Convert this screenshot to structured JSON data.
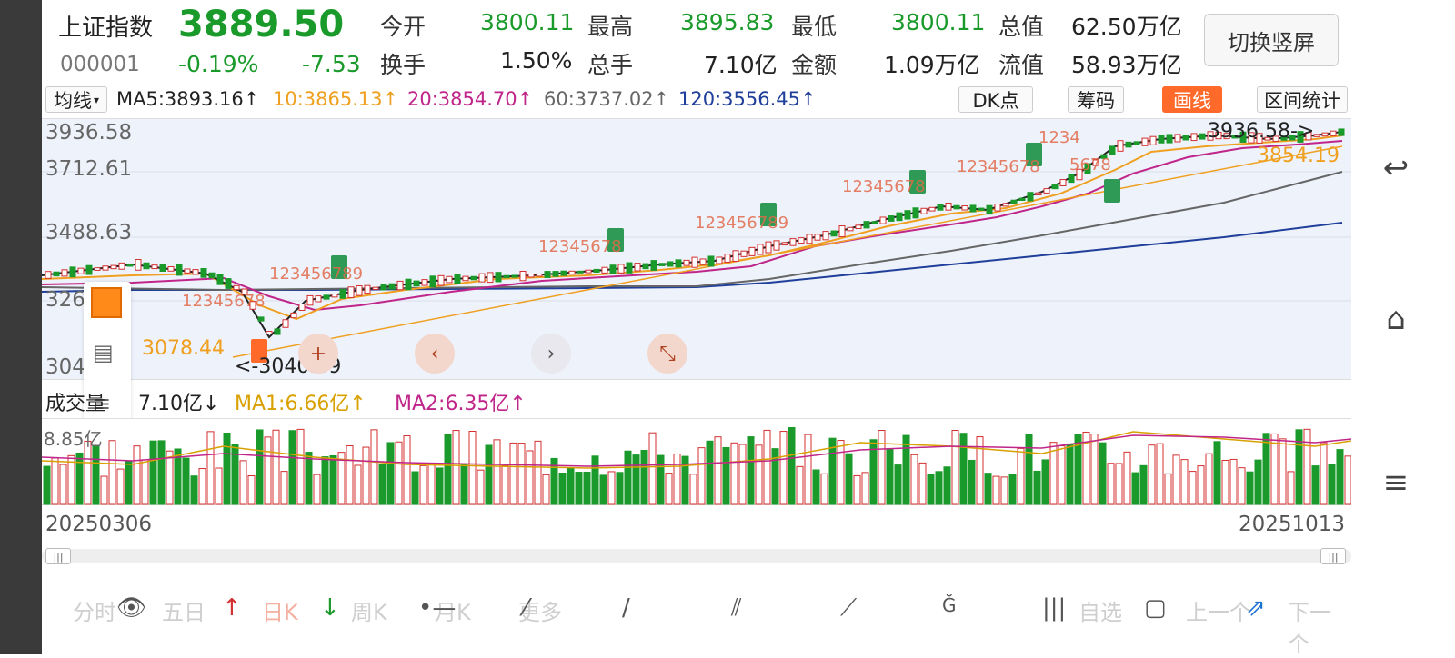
{
  "header": {
    "name": "上证指数",
    "code": "000001",
    "price": "3889.50",
    "change_pct": "-0.19%",
    "change": "-7.53",
    "stats": [
      {
        "label": "今开",
        "value": "3800.11",
        "color": "green"
      },
      {
        "label": "最高",
        "value": "3895.83",
        "color": "green"
      },
      {
        "label": "最低",
        "value": "3800.11",
        "color": "green"
      },
      {
        "label": "总值",
        "value": "62.50万亿",
        "color": "black"
      },
      {
        "label": "换手",
        "value": "1.50%",
        "color": "black"
      },
      {
        "label": "总手",
        "value": "7.10亿",
        "color": "black"
      },
      {
        "label": "金额",
        "value": "1.09万亿",
        "color": "black"
      },
      {
        "label": "流值",
        "value": "58.93万亿",
        "color": "black"
      }
    ],
    "switch_label": "切换竖屏"
  },
  "ma_bar": {
    "selector": "均线",
    "ma5": "MA5:3893.16↑",
    "ma10": "10:3865.13↑",
    "ma20": "20:3854.70↑",
    "ma60": "60:3737.02↑",
    "ma120": "120:3556.45↑",
    "dk_label": "DK点",
    "chip_label": "筹码",
    "draw_label": "画线",
    "range_label": "区间统计"
  },
  "price_axis": {
    "top": "3936.58",
    "upper": "3712.61",
    "middle": "3488.63",
    "lower": "3264.65",
    "bottom": "3040.69"
  },
  "annotations": {
    "high_marker": "3936.58->",
    "ma_value": "3854.19",
    "low_marker": "<-3040.69",
    "low_label": "3078.44",
    "td_sequences": [
      "12345678",
      "123456789",
      "12345678",
      "123456789",
      "12345678",
      "1234",
      "5678",
      "9"
    ]
  },
  "volume_bar": {
    "selector": "成交量",
    "volume": "7.10亿↓",
    "ma1": "MA1:6.66亿↑",
    "ma2": "MA2:6.35亿↑",
    "axis_top": "8.85亿"
  },
  "dates": {
    "start": "20250306",
    "end": "20251013"
  },
  "bottom_tabs": {
    "fenshi": "分时",
    "wuri": "五日",
    "rik": "日K",
    "zhouk": "周K",
    "yuek": "月K",
    "more": "更多",
    "zixuan": "自选",
    "prev": "上一个",
    "next": "下一个"
  },
  "colors": {
    "up": "#d32f2f",
    "down": "#1a9a2a",
    "ma5": "#222222",
    "ma10": "#f0a020",
    "ma20": "#c0258a",
    "ma60": "#666666",
    "ma120": "#1f3f9a",
    "accent": "#ff6a2b"
  }
}
